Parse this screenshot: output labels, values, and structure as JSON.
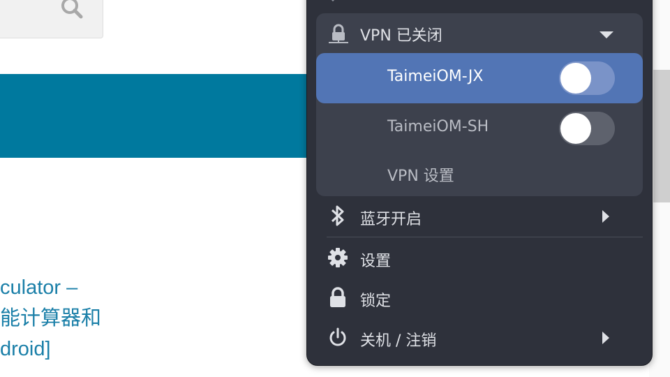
{
  "background": {
    "article_lines": [
      "culator –",
      "能计算器和",
      "droid]"
    ]
  },
  "menu": {
    "vpn": {
      "header_label": "VPN 已关闭",
      "connections": [
        {
          "name": "TaimeiOM-JX",
          "enabled": false,
          "highlighted": true
        },
        {
          "name": "TaimeiOM-SH",
          "enabled": false,
          "highlighted": false
        }
      ],
      "settings_label": "VPN 设置"
    },
    "items": [
      {
        "label": "蓝牙开启",
        "icon": "bluetooth-icon",
        "has_submenu": true
      },
      {
        "label": "设置",
        "icon": "gear-icon",
        "has_submenu": false
      },
      {
        "label": "锁定",
        "icon": "lock-icon",
        "has_submenu": false
      },
      {
        "label": "关机 / 注销",
        "icon": "power-icon",
        "has_submenu": true
      }
    ]
  },
  "colors": {
    "menu_bg": "#2e313b",
    "section_bg": "#3d414d",
    "highlight": "#5275b5",
    "banner": "#00799e",
    "link_text": "#1a7fa8"
  }
}
